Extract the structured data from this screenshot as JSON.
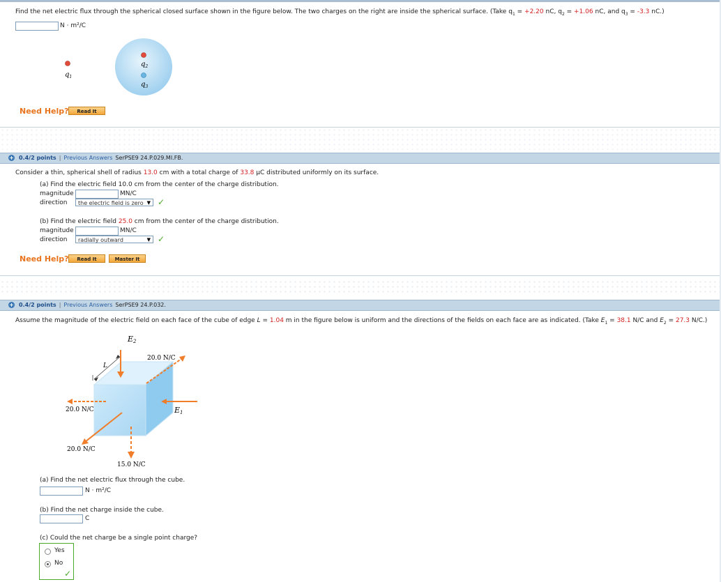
{
  "q1": {
    "prompt_start": "Find the net electric flux through the spherical closed surface shown in the figure below. The two charges on the right are inside the spherical surface. (Take ",
    "q1_label": "q",
    "q1_value": "+2.20",
    "q2_value": "+1.06",
    "q3_value": "-3.3",
    "unit_nc": "nC",
    "answer_unit": "N · m²/C",
    "figure": {
      "q1": "q1",
      "q2": "q2",
      "q3": "q3"
    },
    "need_help": "Need Help?",
    "read_it": "Read It"
  },
  "q2": {
    "header": {
      "points": "0.4/2 points",
      "sep": "|",
      "prev": "Previous Answers",
      "ref": "SerPSE9 24.P.029.MI.FB."
    },
    "prompt_a": "Consider a thin, spherical shell of radius ",
    "radius": "13.0",
    "prompt_b": " cm with a total charge of ",
    "charge": "33.8",
    "prompt_c": " μC distributed uniformly on its surface.",
    "part_a": {
      "prompt_a": "(a) Find the electric field 10.0 cm from the center of the charge distribution.",
      "magnitude_label": "magnitude",
      "unit": "MN/C",
      "direction_label": "direction",
      "direction_value": "the electric field is zero"
    },
    "part_b": {
      "prompt_a": "(b) Find the electric field ",
      "distance": "25.0",
      "prompt_b": " cm from the center of the charge distribution.",
      "magnitude_label": "magnitude",
      "unit": "MN/C",
      "direction_label": "direction",
      "direction_value": "radially outward"
    },
    "need_help": "Need Help?",
    "read_it": "Read It",
    "master_it": "Master It"
  },
  "q3": {
    "header": {
      "points": "0.4/2 points",
      "sep": "|",
      "prev": "Previous Answers",
      "ref": "SerPSE9 24.P.032."
    },
    "prompt_a": "Assume the magnitude of the electric field on each face of the cube of edge ",
    "L_label": "L",
    "L_value": "1.04",
    "prompt_b": " m in the figure below is uniform and the directions of the fields on each face are as indicated. (Take ",
    "E1_value": "38.1",
    "E2_value": "27.3",
    "figure": {
      "E2": "E",
      "E1": "E",
      "L": "L",
      "top_right": "20.0 N/C",
      "left": "20.0 N/C",
      "bottom_left": "20.0 N/C",
      "bottom": "15.0 N/C"
    },
    "part_a": {
      "prompt": "(a) Find the net electric flux through the cube.",
      "unit": "N · m²/C"
    },
    "part_b": {
      "prompt": "(b) Find the net charge inside the cube.",
      "unit": "C"
    },
    "part_c": {
      "prompt": "(c) Could the net charge be a single point charge?",
      "yes": "Yes",
      "no": "No",
      "selected": "No"
    }
  },
  "colors": {
    "header_bar": "#c3d6e6",
    "accent_red": "#d31f1f",
    "need_help": "#e8741e",
    "check": "#4caa2a",
    "arrow": "#f07d2a",
    "cube": "#9fd0f0"
  }
}
